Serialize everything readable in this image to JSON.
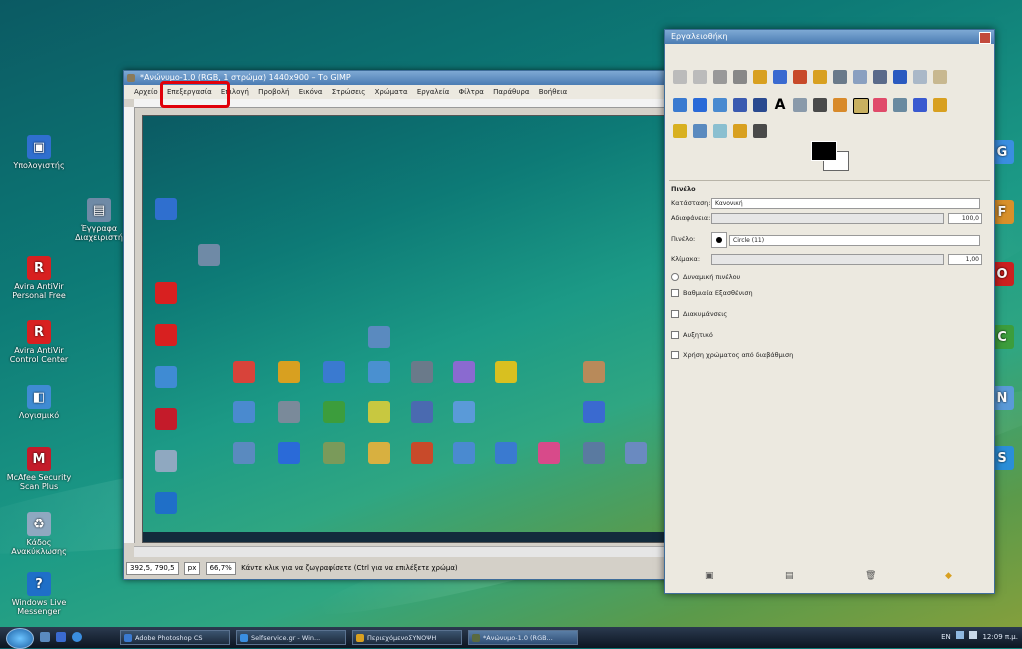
{
  "desktop": {
    "left_icons": [
      {
        "label": "Υπολογιστής",
        "color": "#2f6fcf",
        "icon": "computer-icon"
      },
      {
        "label": "Έγγραφα Διαχειριστή",
        "color": "#6f8aa6",
        "icon": "documents-icon"
      },
      {
        "label": "Avira AntiVir Personal Free",
        "color": "#d82020",
        "icon": "avira-icon"
      },
      {
        "label": "Avira AntiVir Control Center",
        "color": "#d82020",
        "icon": "avira-icon"
      },
      {
        "label": "Λογισμικό",
        "color": "#3f8bd3",
        "icon": "software-icon"
      },
      {
        "label": "McAfee Security Scan Plus",
        "color": "#c41b2a",
        "icon": "mcafee-icon"
      },
      {
        "label": "Κάδος Ανακύκλωσης",
        "color": "#8fa8c0",
        "icon": "recycle-bin-icon"
      },
      {
        "label": "Windows Live Messenger",
        "color": "#1f6fc8",
        "icon": "messenger-icon"
      }
    ],
    "right_icons": [
      {
        "label": "Go",
        "color": "#3a8ee0"
      },
      {
        "label": "Fire",
        "color": "#d8902a"
      },
      {
        "label": "Opera",
        "color": "#cc2020"
      },
      {
        "label": "Chrome",
        "color": "#3c9d3c"
      },
      {
        "label": "Net",
        "color": "#5a9ad8"
      },
      {
        "label": "Skype",
        "color": "#2a8ed8"
      }
    ]
  },
  "image_window": {
    "title": "*Ανώνυμο-1.0 (RGB, 1 στρώμα) 1440x900 – Το GIMP",
    "menus": [
      "Αρχείο",
      "Επεξεργασία",
      "Επιλογή",
      "Προβολή",
      "Εικόνα",
      "Στρώσεις",
      "Χρώματα",
      "Εργαλεία",
      "Φίλτρα",
      "Παράθυρα",
      "Βοήθεια"
    ],
    "highlighted_menu": "Επεξεργασία",
    "status": {
      "coords": "392,5, 790,5",
      "unit": "px",
      "zoom": "66,7%",
      "message": "Κάντε κλικ για να ζωγραφίσετε (Ctrl για να επιλέξετε χρώμα)"
    }
  },
  "toolbox": {
    "title": "Εργαλειοθήκη",
    "options_title": "Πινέλο",
    "mode_label": "Κατάσταση:",
    "mode_value": "Κανονική",
    "opacity_label": "Αδιαφάνεια:",
    "opacity_value": "100,0",
    "brush_label": "Πινέλο:",
    "brush_value": "Circle (11)",
    "scale_label": "Κλίμακα:",
    "scale_value": "1,00",
    "options": [
      {
        "label": "Δυναμική πινέλου",
        "kind": "radio"
      },
      {
        "label": "Βαθμιαία Εξασθένιση",
        "kind": "check"
      },
      {
        "label": "Διακυμάνσεις",
        "kind": "check"
      },
      {
        "label": "Αυξητικό",
        "kind": "check"
      },
      {
        "label": "Χρήση χρώματος από διαβάθμιση",
        "kind": "check"
      }
    ],
    "fg_color": "#000000",
    "bg_color": "#ffffff"
  },
  "taskbar": {
    "buttons": [
      {
        "label": "Adobe Photoshop CS",
        "color": "#3a7ad0",
        "active": false
      },
      {
        "label": "Selfservice.gr - Win...",
        "color": "#3a8ee0",
        "active": false
      },
      {
        "label": "ΠεριεχόμενοΣΥΝΟΨΗ",
        "color": "#d8a020",
        "active": false
      },
      {
        "label": "*Ανώνυμο-1.0 (RGB...",
        "color": "#5a6a40",
        "active": true
      }
    ],
    "tray_lang": "EN",
    "tray_time": "12:09 π.μ."
  }
}
